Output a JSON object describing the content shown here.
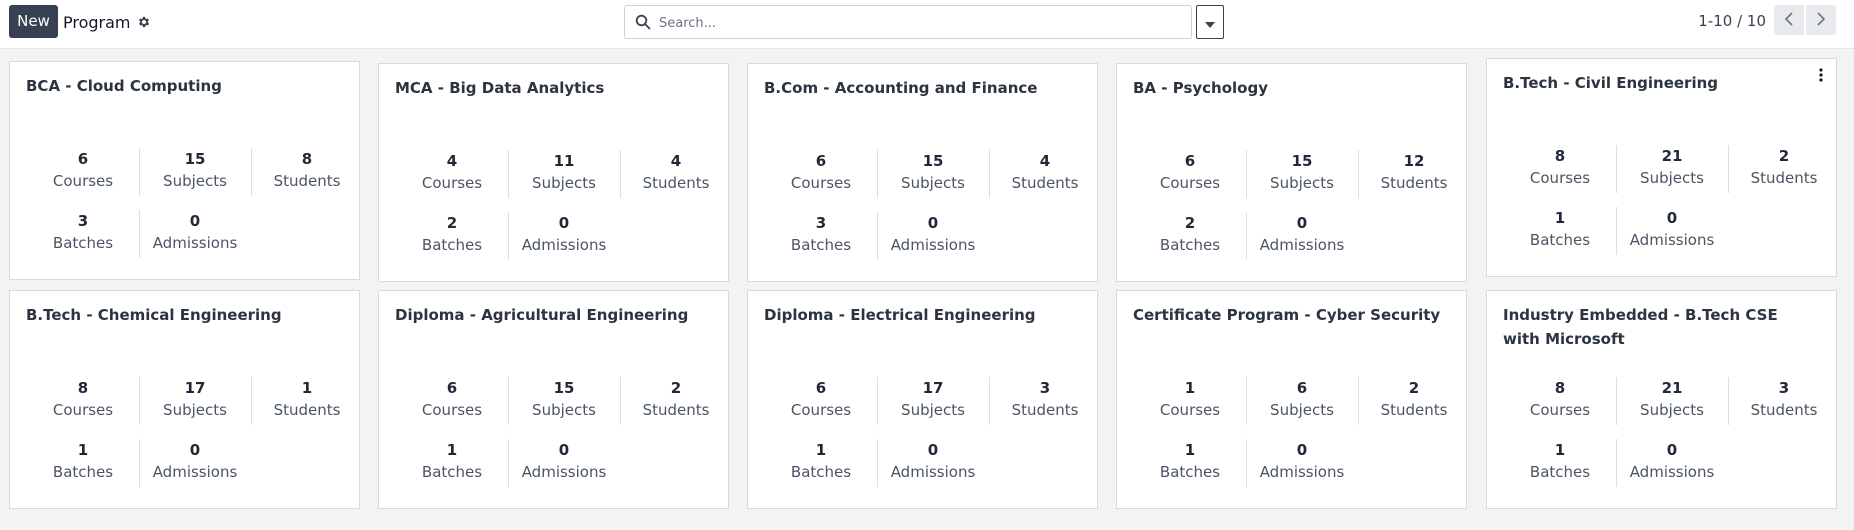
{
  "control": {
    "new_label": "New",
    "breadcrumb": "Program",
    "search_placeholder": "Search...",
    "pager": "1-10 / 10"
  },
  "icons": {
    "settings": "gear-icon",
    "search": "search-icon",
    "dropdown": "caret-down-icon",
    "prev": "chevron-left-icon",
    "next": "chevron-right-icon",
    "card_menu": "vertical-ellipsis-icon"
  },
  "stat_labels": [
    "Courses",
    "Subjects",
    "Students",
    "Batches",
    "Admissions"
  ],
  "programs": [
    {
      "title": "BCA - Cloud Computing",
      "courses": "6",
      "subjects": "15",
      "students": "8",
      "batches": "3",
      "admissions": "0"
    },
    {
      "title": "MCA - Big Data Analytics",
      "courses": "4",
      "subjects": "11",
      "students": "4",
      "batches": "2",
      "admissions": "0"
    },
    {
      "title": "B.Com - Accounting and Finance",
      "courses": "6",
      "subjects": "15",
      "students": "4",
      "batches": "3",
      "admissions": "0"
    },
    {
      "title": "BA - Psychology",
      "courses": "6",
      "subjects": "15",
      "students": "12",
      "batches": "2",
      "admissions": "0"
    },
    {
      "title": "B.Tech - Civil Engineering",
      "courses": "8",
      "subjects": "21",
      "students": "2",
      "batches": "1",
      "admissions": "0"
    },
    {
      "title": "B.Tech - Chemical Engineering",
      "courses": "8",
      "subjects": "17",
      "students": "1",
      "batches": "1",
      "admissions": "0"
    },
    {
      "title": "Diploma - Agricultural Engineering",
      "courses": "6",
      "subjects": "15",
      "students": "2",
      "batches": "1",
      "admissions": "0"
    },
    {
      "title": "Diploma - Electrical Engineering",
      "courses": "6",
      "subjects": "17",
      "students": "3",
      "batches": "1",
      "admissions": "0"
    },
    {
      "title": "Certificate Program - Cyber Security",
      "courses": "1",
      "subjects": "6",
      "students": "2",
      "batches": "1",
      "admissions": "0"
    },
    {
      "title": "Industry Embedded - B.Tech CSE with Microsoft",
      "courses": "8",
      "subjects": "21",
      "students": "3",
      "batches": "1",
      "admissions": "0"
    }
  ],
  "colors": {
    "accent": "#374151",
    "background": "#f2f3f5",
    "card_border": "#d8dadd"
  }
}
